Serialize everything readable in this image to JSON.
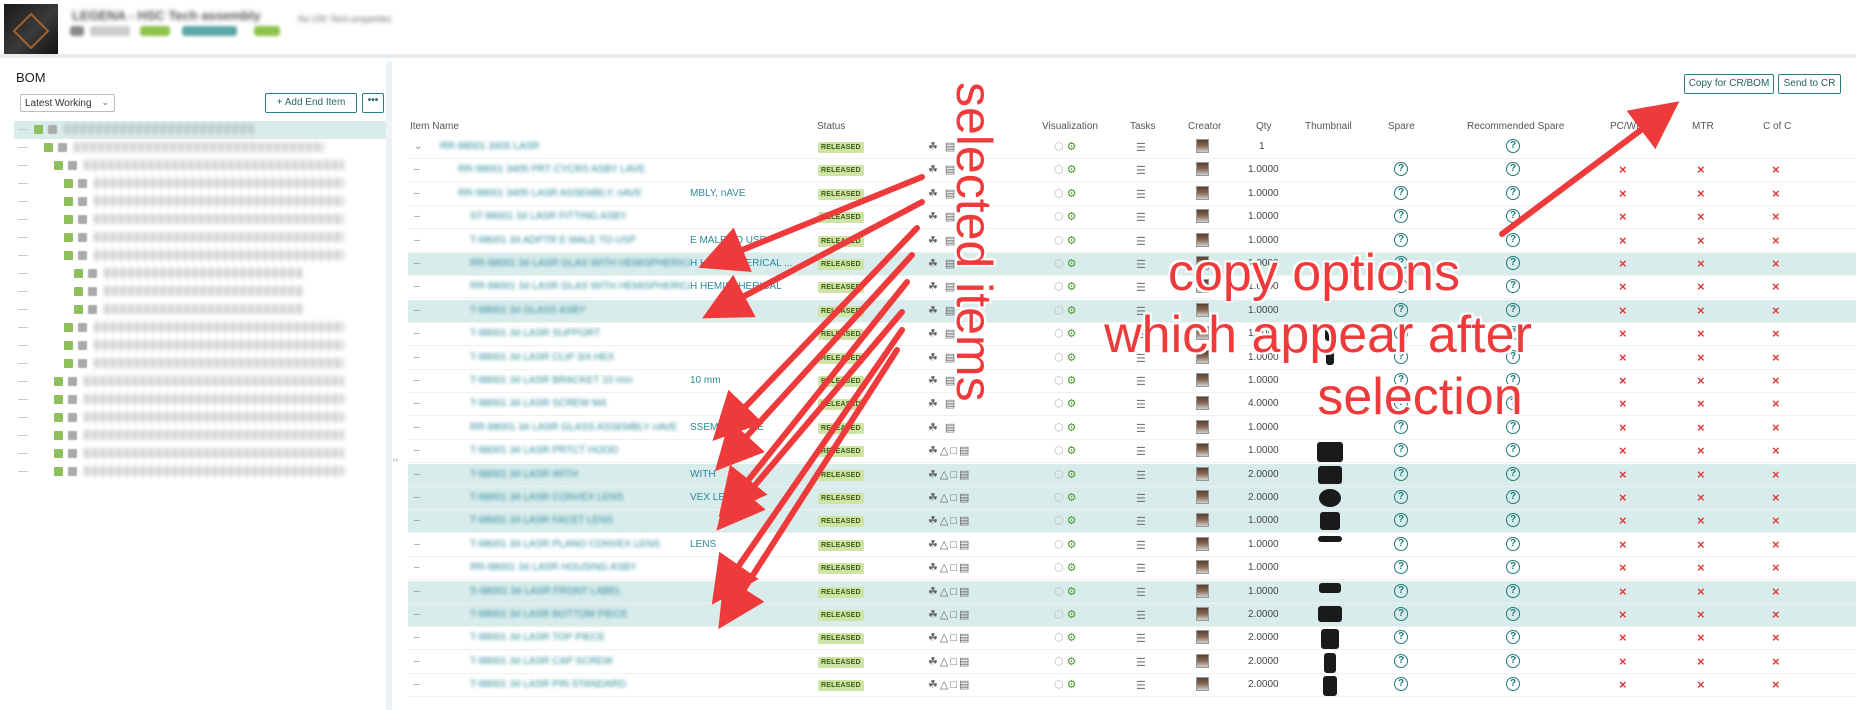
{
  "header": {
    "title": "LEGENA - HSC Tech assembly",
    "subtitle": "No CR/ Tech properties"
  },
  "left_panel": {
    "title": "BOM",
    "version_select": "Latest Working",
    "add_button": "Add End Item",
    "more_button": "•••"
  },
  "toolbar": {
    "copy_button": "Copy for CR/BOM",
    "send_button": "Send to CR"
  },
  "columns": {
    "item_name": "Item Name",
    "status": "Status",
    "visualization": "Visualization",
    "tasks": "Tasks",
    "creator": "Creator",
    "qty": "Qty",
    "thumbnail": "Thumbnail",
    "spare": "Spare",
    "recommended_spare": "Recommended Spare",
    "pcwi": "PC/WI",
    "mtr": "MTR",
    "cofc": "C of C"
  },
  "rows": [
    {
      "name": "RR-98001 3405 LASR",
      "visible": "",
      "status": "RELEASED",
      "qty": "1",
      "selected": false
    },
    {
      "name": "RR-98001 3405 PRT CYCRS ASBY LAVE",
      "visible": "",
      "status": "RELEASED",
      "qty": "1.0000",
      "selected": false
    },
    {
      "name": "RR-98001 3405 LASR ASSEMBLY, nAVE",
      "visible": "MBLY, nAVE",
      "status": "RELEASED",
      "qty": "1.0000",
      "selected": false
    },
    {
      "name": "ST-98001 34 LASR FITTING ASBY",
      "visible": "",
      "status": "RELEASED",
      "qty": "1.0000",
      "selected": false
    },
    {
      "name": "T-98001 34 ADPTR E MALE TO USP",
      "visible": "E MALE TO USP",
      "status": "RELEASED",
      "qty": "1.0000",
      "selected": false
    },
    {
      "name": "RR-98001 34 LASR GLAS WITH HEMISPHERICAL ...",
      "visible": "H HEMISPHERICAL ...",
      "status": "RELEASED",
      "qty": "1.0000",
      "selected": true
    },
    {
      "name": "RR-98001 34 LASR GLAS WITH HEMISPHERICAL",
      "visible": "H HEMISPHERICAL",
      "status": "RELEASED",
      "qty": "1.0000",
      "selected": false
    },
    {
      "name": "T-98001 34 GLASS ASBY",
      "visible": "",
      "status": "RELEASED",
      "qty": "1.0000",
      "selected": true
    },
    {
      "name": "T-98001 34 LASR SUPPORT",
      "visible": "",
      "status": "RELEASED",
      "qty": "1.0000",
      "selected": false
    },
    {
      "name": "T-98001 34 LASR CLIP 3/4 HEX",
      "visible": "",
      "status": "RELEASED",
      "qty": "1.0000",
      "selected": false
    },
    {
      "name": "T-98001 34 LASR BRACKET 10 mm",
      "visible": "10 mm",
      "status": "RELEASED",
      "qty": "1.0000",
      "selected": false
    },
    {
      "name": "T-98001 34 LASR SCREW M4",
      "visible": "",
      "status": "RELEASED",
      "qty": "4.0000",
      "selected": false
    },
    {
      "name": "RR-98001 34 LASR GLASS ASSEMBLY nAVE",
      "visible": "SSEMBLY nAVE",
      "status": "RELEASED",
      "qty": "1.0000",
      "selected": false
    },
    {
      "name": "T-98001 34 LASR PRTCT HOOD",
      "visible": "",
      "status": "RELEASED",
      "qty": "1.0000",
      "selected": false
    },
    {
      "name": "T-98001 34 LASR WITH",
      "visible": "WITH",
      "status": "RELEASED",
      "qty": "2.0000",
      "selected": true
    },
    {
      "name": "T-98001 34 LASR CONVEX LENS",
      "visible": "VEX LEN",
      "status": "RELEASED",
      "qty": "2.0000",
      "selected": true
    },
    {
      "name": "T-98001 34 LASR FACET LENS",
      "visible": "",
      "status": "RELEASED",
      "qty": "1.0000",
      "selected": true
    },
    {
      "name": "T-98001 34 LASR PLANO CONVEX LENS",
      "visible": "LENS",
      "status": "RELEASED",
      "qty": "1.0000",
      "selected": false
    },
    {
      "name": "RR-98001 34 LASR HOUSING ASBY",
      "visible": "",
      "status": "RELEASED",
      "qty": "1.0000",
      "selected": false
    },
    {
      "name": "S-98001 34 LASR FRONT LABEL",
      "visible": "",
      "status": "RELEASED",
      "qty": "1.0000",
      "selected": true
    },
    {
      "name": "T-98001 34 LASR BOTTOM PIECE",
      "visible": "",
      "status": "RELEASED",
      "qty": "2.0000",
      "selected": true
    },
    {
      "name": "T-98001 34 LASR TOP PIECE",
      "visible": "",
      "status": "RELEASED",
      "qty": "2.0000",
      "selected": false
    },
    {
      "name": "T-98001 34 LASR CAP SCREW",
      "visible": "",
      "status": "RELEASED",
      "qty": "2.0000",
      "selected": false
    },
    {
      "name": "T-98001 34 LASR PIN STANDARD",
      "visible": "",
      "status": "RELEASED",
      "qty": "2.0000",
      "selected": false
    }
  ],
  "annotations": {
    "vertical": "selected items",
    "copy_options": [
      "copy options",
      "which appear after",
      "selection"
    ],
    "color": "#ee3a3a"
  }
}
